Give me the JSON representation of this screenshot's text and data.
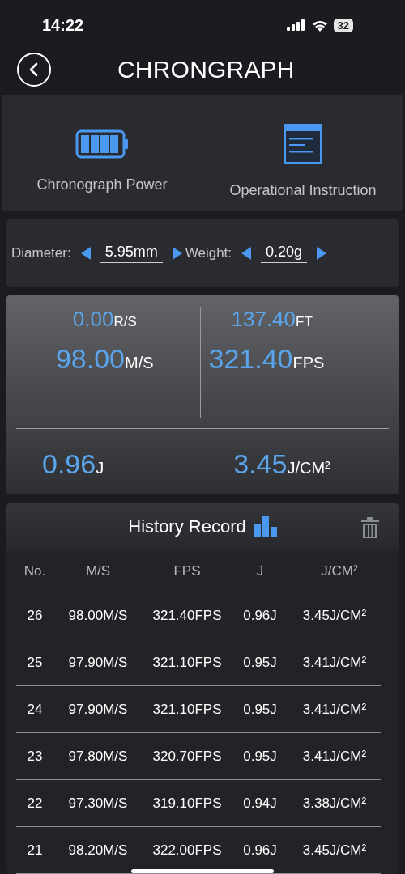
{
  "status_bar": {
    "time": "14:22",
    "battery": "32"
  },
  "header": {
    "title": "CHRONGRAPH"
  },
  "tiles": [
    {
      "kind": "battery",
      "label": "Chronograph Power"
    },
    {
      "kind": "document",
      "label": "Operational Instruction"
    }
  ],
  "settings": [
    {
      "label": "Diameter:",
      "value": "5.95mm"
    },
    {
      "label": "Weight:",
      "value": "0.20g"
    }
  ],
  "readings": {
    "left": [
      {
        "kind": "small",
        "value": "0.00",
        "unit": "R/S"
      },
      {
        "kind": "large",
        "value": "98.00",
        "unit": "M/S"
      }
    ],
    "right": [
      {
        "kind": "small",
        "value": "137.40",
        "unit": "FT"
      },
      {
        "kind": "large",
        "value": "321.40",
        "unit": "FPS"
      }
    ],
    "bottom": [
      {
        "value": "0.96",
        "unit": "J"
      },
      {
        "value": "3.45",
        "unit": "J/CM²"
      }
    ]
  },
  "history": {
    "title": "History Record",
    "columns": [
      "No.",
      "M/S",
      "FPS",
      "J",
      "J/CM²"
    ],
    "rows": [
      [
        "26",
        "98.00M/S",
        "321.40FPS",
        "0.96J",
        "3.45J/CM²"
      ],
      [
        "25",
        "97.90M/S",
        "321.10FPS",
        "0.95J",
        "3.41J/CM²"
      ],
      [
        "24",
        "97.90M/S",
        "321.10FPS",
        "0.95J",
        "3.41J/CM²"
      ],
      [
        "23",
        "97.80M/S",
        "320.70FPS",
        "0.95J",
        "3.41J/CM²"
      ],
      [
        "22",
        "97.30M/S",
        "319.10FPS",
        "0.94J",
        "3.38J/CM²"
      ],
      [
        "21",
        "98.20M/S",
        "322.00FPS",
        "0.96J",
        "3.45J/CM²"
      ]
    ]
  }
}
